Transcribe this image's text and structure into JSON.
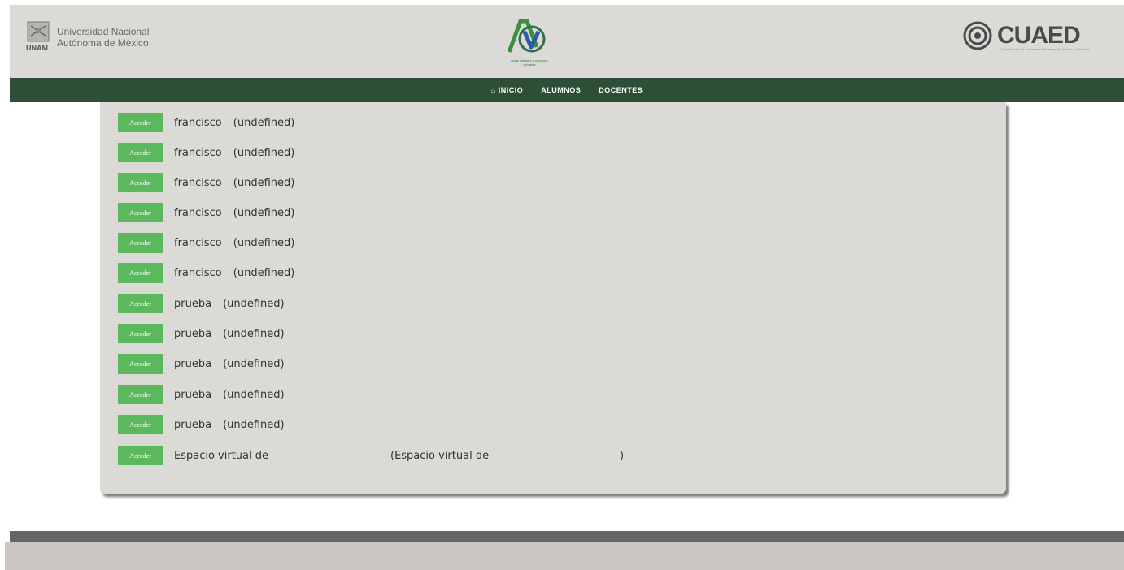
{
  "header": {
    "unam_name_line1": "Universidad Nacional",
    "unam_name_line2": "Autónoma de México",
    "unam_abbr": "UNAM",
    "av_caption": "aulas virtuales y espacios virtuales",
    "cuaed_name": "CUAED",
    "cuaed_subtitle": "Coordinación de Universidad Abierta y Educación a Distancia"
  },
  "nav": {
    "items": [
      {
        "label": "INICIO",
        "icon": "home-icon"
      },
      {
        "label": "ALUMNOS"
      },
      {
        "label": "DOCENTES"
      }
    ]
  },
  "list": {
    "button_label": "Acceder",
    "rows": [
      {
        "name": "francisco",
        "detail": "(undefined)"
      },
      {
        "name": "francisco",
        "detail": "(undefined)"
      },
      {
        "name": "francisco",
        "detail": "(undefined)"
      },
      {
        "name": "francisco",
        "detail": "(undefined)"
      },
      {
        "name": "francisco",
        "detail": "(undefined)"
      },
      {
        "name": "francisco",
        "detail": "(undefined)"
      },
      {
        "name": "prueba",
        "detail": "(undefined)"
      },
      {
        "name": "prueba",
        "detail": "(undefined)"
      },
      {
        "name": "prueba",
        "detail": "(undefined)"
      },
      {
        "name": "prueba",
        "detail": "(undefined)"
      },
      {
        "name": "prueba",
        "detail": "(undefined)"
      },
      {
        "name": "Espacio virtual de",
        "detail": "(Espacio virtual de",
        "detail_close": ")"
      }
    ]
  },
  "colors": {
    "nav_bg": "#2c4f35",
    "button_bg": "#5cb85c",
    "panel_bg": "#dcdad7",
    "footer_dark": "#666566",
    "footer_light": "#cbc7c3"
  }
}
